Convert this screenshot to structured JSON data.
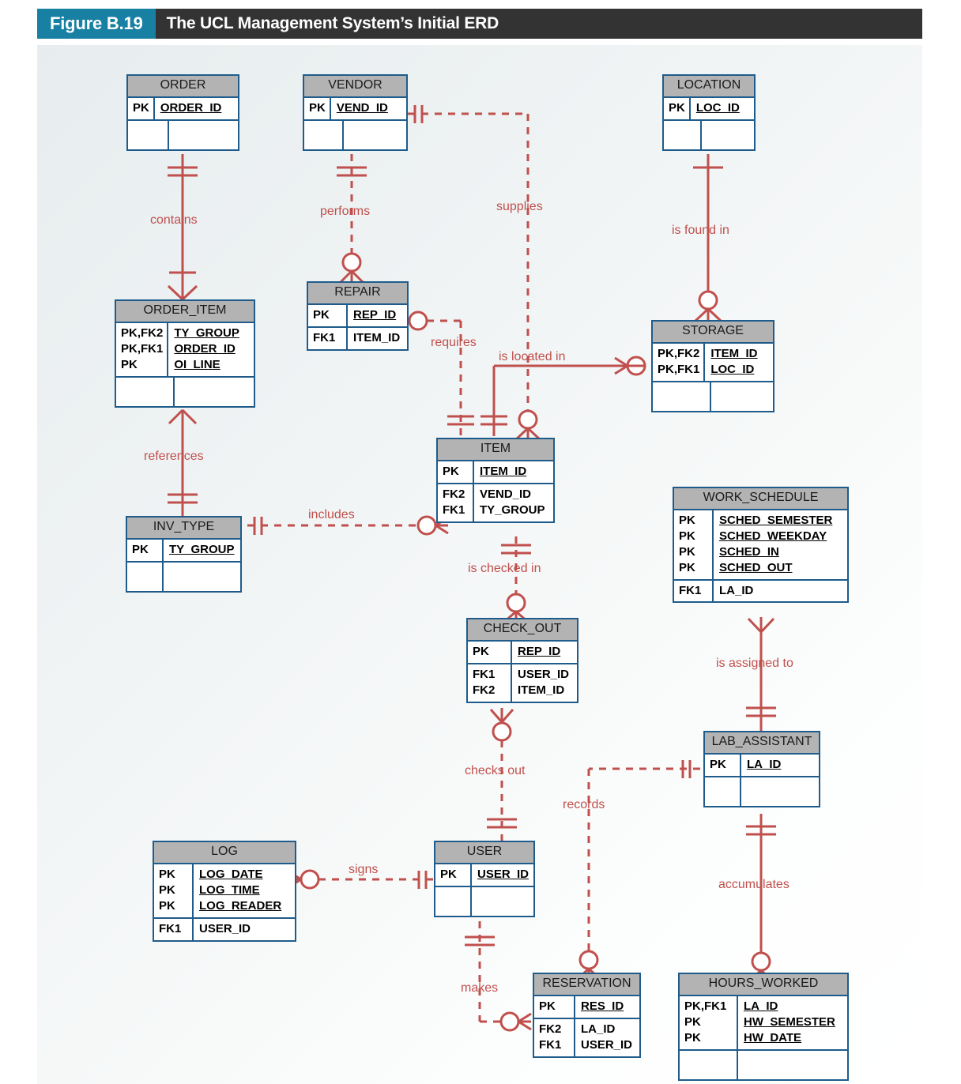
{
  "figure": {
    "number": "Figure B.19",
    "title": "The UCL Management System’s Initial ERD"
  },
  "colors": {
    "figure_tag_bg": "#1880a3",
    "title_bar_bg": "#333333",
    "entity_border": "#1f5c8b",
    "entity_header_bg": "#b3b3b3",
    "connector": "#c0504d"
  },
  "entities": {
    "order": {
      "name": "ORDER",
      "keys1": [
        "PK"
      ],
      "attrs1": [
        "ORDER_ID"
      ]
    },
    "vendor": {
      "name": "VENDOR",
      "keys1": [
        "PK"
      ],
      "attrs1": [
        "VEND_ID"
      ]
    },
    "location": {
      "name": "LOCATION",
      "keys1": [
        "PK"
      ],
      "attrs1": [
        "LOC_ID"
      ]
    },
    "order_item": {
      "name": "ORDER_ITEM",
      "keys1": [
        "PK,FK2",
        "PK,FK1",
        "PK"
      ],
      "attrs1": [
        "TY_GROUP",
        "ORDER_ID",
        "OI_LINE"
      ]
    },
    "repair": {
      "name": "REPAIR",
      "keys1": [
        "PK"
      ],
      "attrs1": [
        "REP_ID"
      ],
      "keys2": [
        "FK1"
      ],
      "attrs2": [
        "ITEM_ID"
      ]
    },
    "storage": {
      "name": "STORAGE",
      "keys1": [
        "PK,FK2",
        "PK,FK1"
      ],
      "attrs1": [
        "ITEM_ID",
        "LOC_ID"
      ]
    },
    "item": {
      "name": "ITEM",
      "keys1": [
        "PK"
      ],
      "attrs1": [
        "ITEM_ID"
      ],
      "keys2": [
        "FK2",
        "FK1"
      ],
      "attrs2": [
        "VEND_ID",
        "TY_GROUP"
      ]
    },
    "inv_type": {
      "name": "INV_TYPE",
      "keys1": [
        "PK"
      ],
      "attrs1": [
        "TY_GROUP"
      ]
    },
    "work_schedule": {
      "name": "WORK_SCHEDULE",
      "keys1": [
        "PK",
        "PK",
        "PK",
        "PK"
      ],
      "attrs1": [
        "SCHED_SEMESTER",
        "SCHED_WEEKDAY",
        "SCHED_IN",
        "SCHED_OUT"
      ],
      "keys2": [
        "FK1"
      ],
      "attrs2": [
        "LA_ID"
      ]
    },
    "check_out": {
      "name": "CHECK_OUT",
      "keys1": [
        "PK"
      ],
      "attrs1": [
        "REP_ID"
      ],
      "keys2": [
        "FK1",
        "FK2"
      ],
      "attrs2": [
        "USER_ID",
        "ITEM_ID"
      ]
    },
    "lab_assistant": {
      "name": "LAB_ASSISTANT",
      "keys1": [
        "PK"
      ],
      "attrs1": [
        "LA_ID"
      ]
    },
    "log": {
      "name": "LOG",
      "keys1": [
        "PK",
        "PK",
        "PK"
      ],
      "attrs1": [
        "LOG_DATE",
        "LOG_TIME",
        "LOG_READER"
      ],
      "keys2": [
        "FK1"
      ],
      "attrs2": [
        "USER_ID"
      ]
    },
    "user": {
      "name": "USER",
      "keys1": [
        "PK"
      ],
      "attrs1": [
        "USER_ID"
      ]
    },
    "reservation": {
      "name": "RESERVATION",
      "keys1": [
        "PK"
      ],
      "attrs1": [
        "RES_ID"
      ],
      "keys2": [
        "FK2",
        "FK1"
      ],
      "attrs2": [
        "LA_ID",
        "USER_ID"
      ]
    },
    "hours_worked": {
      "name": "HOURS_WORKED",
      "keys1": [
        "PK,FK1",
        "PK",
        "PK"
      ],
      "attrs1": [
        "LA_ID",
        "HW_SEMESTER",
        "HW_DATE"
      ]
    }
  },
  "relationships": [
    {
      "id": "contains",
      "label": "contains",
      "from": "ORDER",
      "to": "ORDER_ITEM",
      "line": "solid"
    },
    {
      "id": "performs",
      "label": "performs",
      "from": "VENDOR",
      "to": "REPAIR",
      "line": "dashed"
    },
    {
      "id": "supplies",
      "label": "supplies",
      "from": "VENDOR",
      "to": "ITEM",
      "line": "dashed"
    },
    {
      "id": "is-found-in",
      "label": "is found in",
      "from": "LOCATION",
      "to": "STORAGE",
      "line": "solid"
    },
    {
      "id": "references",
      "label": "references",
      "from": "ORDER_ITEM",
      "to": "INV_TYPE",
      "line": "solid"
    },
    {
      "id": "requires",
      "label": "requires",
      "from": "REPAIR",
      "to": "ITEM",
      "line": "dashed"
    },
    {
      "id": "is-located-in",
      "label": "is located in",
      "from": "STORAGE",
      "to": "ITEM",
      "line": "solid"
    },
    {
      "id": "includes",
      "label": "includes",
      "from": "INV_TYPE",
      "to": "ITEM",
      "line": "dashed"
    },
    {
      "id": "is-checked-in",
      "label": "is checked in",
      "from": "ITEM",
      "to": "CHECK_OUT",
      "line": "dashed"
    },
    {
      "id": "is-assigned-to",
      "label": "is assigned to",
      "from": "WORK_SCHEDULE",
      "to": "LAB_ASSISTANT",
      "line": "dashed"
    },
    {
      "id": "checks-out",
      "label": "checks out",
      "from": "CHECK_OUT",
      "to": "USER",
      "line": "dashed"
    },
    {
      "id": "records",
      "label": "records",
      "from": "LAB_ASSISTANT",
      "to": "RESERVATION",
      "line": "dashed"
    },
    {
      "id": "accumulates",
      "label": "accumulates",
      "from": "LAB_ASSISTANT",
      "to": "HOURS_WORKED",
      "line": "solid"
    },
    {
      "id": "signs",
      "label": "signs",
      "from": "LOG",
      "to": "USER",
      "line": "dashed"
    },
    {
      "id": "makes",
      "label": "makes",
      "from": "USER",
      "to": "RESERVATION",
      "line": "dashed"
    }
  ]
}
